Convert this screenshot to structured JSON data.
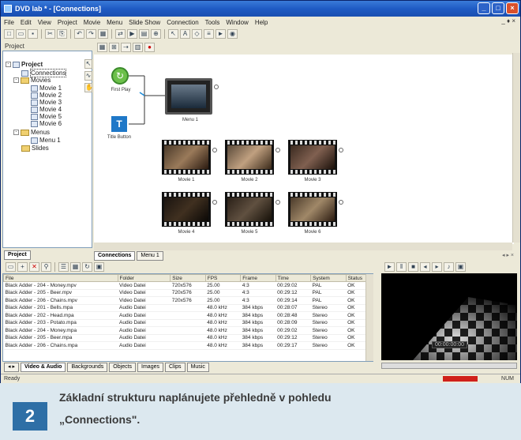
{
  "window": {
    "title": "DVD lab * - [Connections]"
  },
  "menu": [
    "File",
    "Edit",
    "View",
    "Project",
    "Movie",
    "Menu",
    "Slide Show",
    "Connection",
    "Tools",
    "Window",
    "Help"
  ],
  "mdi_controls": "_ ♦ ×",
  "project_panel": {
    "title": "Project",
    "tab": "Project"
  },
  "tree": {
    "root": "Project",
    "connections": "Connections",
    "movies_folder": "Movies",
    "movies": [
      "Movie 1",
      "Movie 2",
      "Movie 3",
      "Movie 4",
      "Movie 5",
      "Movie 6"
    ],
    "menus_folder": "Menus",
    "menus": [
      "Menu 1"
    ],
    "slides_folder": "Slides"
  },
  "canvas": {
    "first_play": "First Play",
    "title_button": "Title Button",
    "menu_node": "Menu 1",
    "movie_nodes": [
      "Movie 1",
      "Movie 2",
      "Movie 3",
      "Movie 4",
      "Movie 5",
      "Movie 6"
    ],
    "pin_label": "Movie 1",
    "t_label": "T",
    "fp_label": "↻"
  },
  "center_tabs": [
    "Connections",
    "Menu 1"
  ],
  "assets": {
    "columns": [
      "File",
      "Folder",
      "Size",
      "FPS",
      "Frame",
      "Time",
      "System",
      "Status"
    ],
    "rows": [
      [
        "Black Adder - 204 - Money.mpv",
        "Video Datei",
        "720x576",
        "25.00",
        "4:3",
        "00:29:02",
        "PAL",
        "OK"
      ],
      [
        "Black Adder - 205 - Beer.mpv",
        "Video Datei",
        "720x576",
        "25.00",
        "4:3",
        "00:29:12",
        "PAL",
        "OK"
      ],
      [
        "Black Adder - 206 - Chains.mpv",
        "Video Datei",
        "720x576",
        "25.00",
        "4:3",
        "00:29:14",
        "PAL",
        "OK"
      ],
      [
        "Black Adder - 201 - Bells.mpa",
        "Audio Datei",
        "",
        "48.0 kHz",
        "384 kbps",
        "00:28:07",
        "Stereo",
        "OK"
      ],
      [
        "Black Adder - 202 - Head.mpa",
        "Audio Datei",
        "",
        "48.0 kHz",
        "384 kbps",
        "00:28:48",
        "Stereo",
        "OK"
      ],
      [
        "Black Adder - 203 - Potato.mpa",
        "Audio Datei",
        "",
        "48.0 kHz",
        "384 kbps",
        "00:28:09",
        "Stereo",
        "OK"
      ],
      [
        "Black Adder - 204 - Money.mpa",
        "Audio Datei",
        "",
        "48.0 kHz",
        "384 kbps",
        "00:29:02",
        "Stereo",
        "OK"
      ],
      [
        "Black Adder - 205 - Beer.mpa",
        "Audio Datei",
        "",
        "48.0 kHz",
        "384 kbps",
        "00:29:12",
        "Stereo",
        "OK"
      ],
      [
        "Black Adder - 206 - Chains.mpa",
        "Audio Datei",
        "",
        "48.0 kHz",
        "384 kbps",
        "00:29:17",
        "Stereo",
        "OK"
      ]
    ],
    "tabs": [
      "Video & Audio",
      "Backgrounds",
      "Objects",
      "Images",
      "Clips",
      "Music"
    ]
  },
  "preview": {
    "timecode": "00:00:00:00"
  },
  "status": {
    "left": "Ready",
    "right": "NUM"
  },
  "caption": {
    "number": "2",
    "line1": "Základní strukturu naplánujete přehledně v pohledu",
    "line2": "„Connections\"."
  },
  "colors": {
    "titlebar": "#1f5bc4",
    "badge": "#2e6fa6",
    "caption_bg": "#dce8ef"
  }
}
